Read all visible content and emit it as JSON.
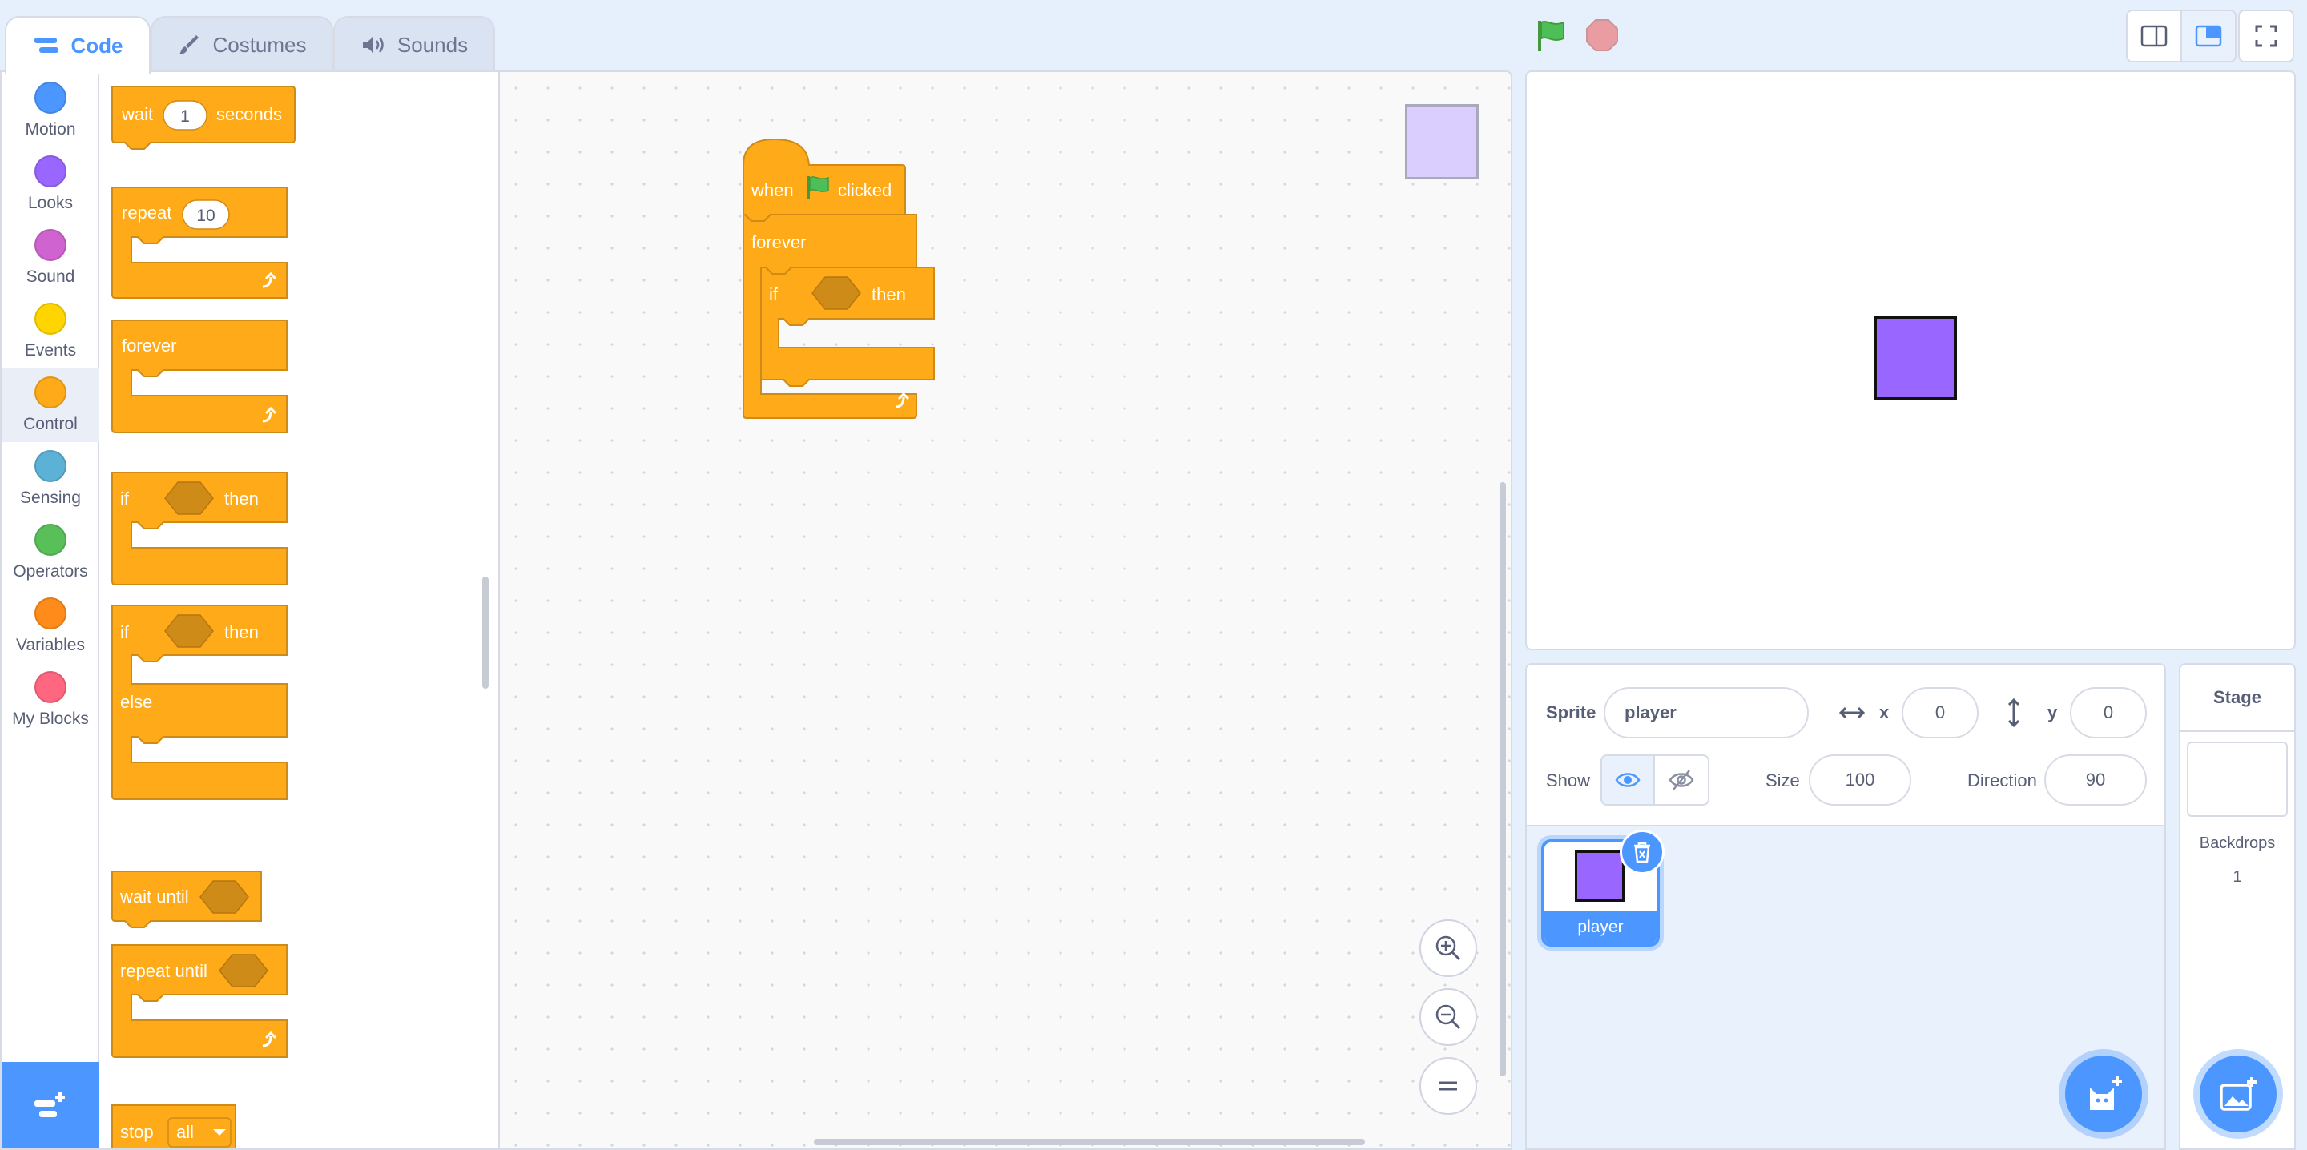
{
  "tabs": [
    {
      "label": "Code",
      "icon": "code-icon"
    },
    {
      "label": "Costumes",
      "icon": "brush-icon"
    },
    {
      "label": "Sounds",
      "icon": "speaker-icon"
    }
  ],
  "categories": [
    {
      "label": "Motion",
      "color": "#4c97ff"
    },
    {
      "label": "Looks",
      "color": "#9966ff"
    },
    {
      "label": "Sound",
      "color": "#cf63cf"
    },
    {
      "label": "Events",
      "color": "#ffd500"
    },
    {
      "label": "Control",
      "color": "#ffab19",
      "selected": true
    },
    {
      "label": "Sensing",
      "color": "#5cb1d6"
    },
    {
      "label": "Operators",
      "color": "#59c059"
    },
    {
      "label": "Variables",
      "color": "#ff8c1a"
    },
    {
      "label": "My Blocks",
      "color": "#ff6680"
    }
  ],
  "palette": {
    "wait": {
      "label": "wait",
      "value": "1",
      "suffix": "seconds"
    },
    "repeat": {
      "label": "repeat",
      "value": "10"
    },
    "forever": {
      "label": "forever"
    },
    "if_then": {
      "if": "if",
      "then": "then"
    },
    "if_else": {
      "if": "if",
      "then": "then",
      "else": "else"
    },
    "wait_until": {
      "label": "wait until"
    },
    "repeat_until": {
      "label": "repeat until"
    },
    "stop": {
      "label": "stop",
      "option": "all"
    }
  },
  "script": {
    "hat_when": "when",
    "hat_clicked": "clicked",
    "forever": "forever",
    "if": "if",
    "then": "then"
  },
  "sprite_info": {
    "sprite_label": "Sprite",
    "name": "player",
    "x_label": "x",
    "x_value": "0",
    "y_label": "y",
    "y_value": "0",
    "show_label": "Show",
    "size_label": "Size",
    "size_value": "100",
    "direction_label": "Direction",
    "direction_value": "90"
  },
  "sprites": [
    {
      "name": "player",
      "color": "#9966ff",
      "selected": true
    }
  ],
  "stage_panel": {
    "title": "Stage",
    "backdrops_label": "Backdrops",
    "backdrops_count": "1"
  },
  "colors": {
    "accent": "#4c97ff",
    "control": "#ffab19",
    "sprite": "#9966ff",
    "green_flag": "#4cbf56",
    "stop": "#ec5959"
  }
}
